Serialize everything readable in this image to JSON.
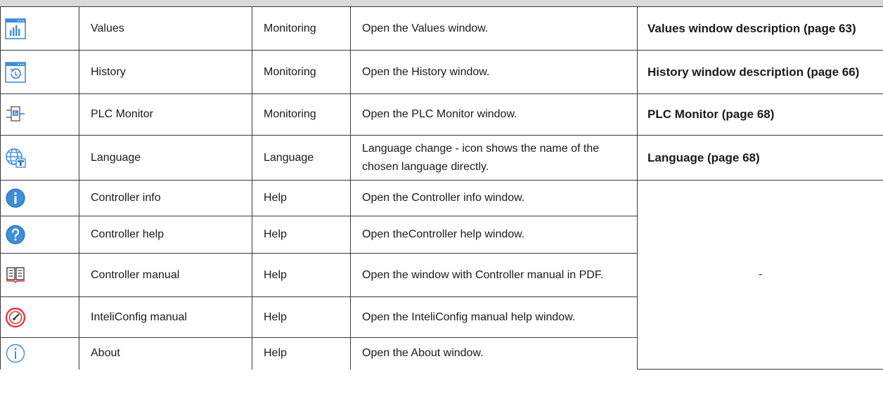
{
  "rows": [
    {
      "icon": "values-window-icon",
      "name": "Values",
      "group": "Monitoring",
      "description": "Open the Values window.",
      "reference": "Values window description (page 63)"
    },
    {
      "icon": "history-window-icon",
      "name": "History",
      "group": "Monitoring",
      "description": "Open the History window.",
      "reference": "History window description (page 66)"
    },
    {
      "icon": "plc-monitor-icon",
      "name": "PLC Monitor",
      "group": "Monitoring",
      "description": "Open the PLC Monitor window.",
      "reference": "PLC Monitor (page 68)"
    },
    {
      "icon": "language-globe-icon",
      "name": "Language",
      "group": "Language",
      "description": "Language change - icon shows the name of the chosen language directly.",
      "reference": "Language (page 68)"
    },
    {
      "icon": "info-filled-icon",
      "name": "Controller info",
      "group": "Help",
      "description": "Open the Controller info window."
    },
    {
      "icon": "question-icon",
      "name": "Controller help",
      "group": "Help",
      "description": "Open theController help window."
    },
    {
      "icon": "book-icon",
      "name": "Controller manual",
      "group": "Help",
      "description": "Open the window with Controller manual in PDF."
    },
    {
      "icon": "gauge-icon",
      "name": "InteliConfig manual",
      "group": "Help",
      "description": "Open the InteliConfig manual help window."
    },
    {
      "icon": "info-outline-icon",
      "name": "About",
      "group": "Help",
      "description": "Open the About window."
    }
  ],
  "help_reference": "-",
  "colors": {
    "icon_blue": "#3c8fd9",
    "gauge_red": "#e03c3c",
    "book_red": "#d9322e",
    "border": "#3a3a3a"
  }
}
